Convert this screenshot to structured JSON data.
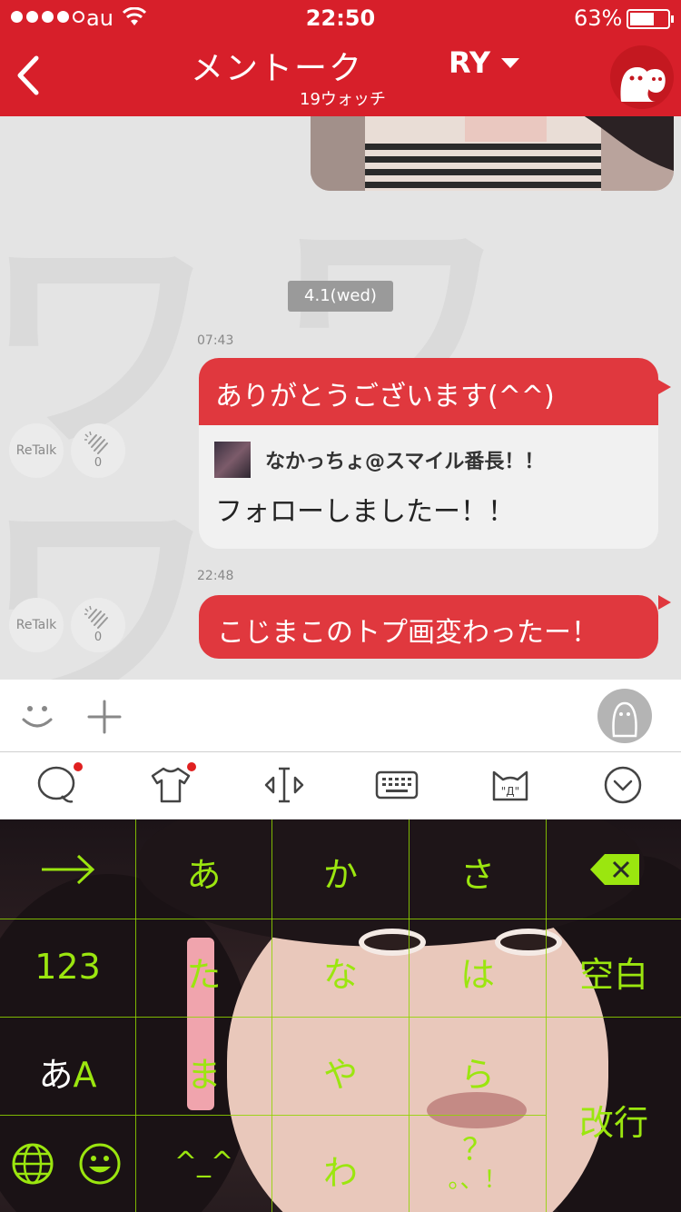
{
  "status_bar": {
    "carrier": "au",
    "time": "22:50",
    "battery": "63%",
    "signal_bars_filled": 4,
    "signal_bars_total": 5
  },
  "nav": {
    "title": "メントーク",
    "subtitle": "19ウォッチ",
    "user_select": "RY"
  },
  "chat": {
    "date_separator": "4.1(wed)",
    "messages": [
      {
        "time": "07:43",
        "text": "ありがとうございます(^^)",
        "quote_name": "なかっちょ@スマイル番長！！",
        "quote_text": "フォローしましたー！！",
        "retalk_label": "ReTalk",
        "clap_count": "0"
      },
      {
        "time": "22:48",
        "text": "こじまこのトプ画変わったー！",
        "retalk_label": "ReTalk",
        "clap_count": "0"
      }
    ]
  },
  "input_bar": {
    "icons": [
      "smile-icon",
      "plus-icon",
      "stamp-avatar"
    ]
  },
  "kb_toolbar": {
    "icons": [
      "chat-bubble-icon",
      "tshirt-icon",
      "cursor-move-icon",
      "keyboard-icon",
      "cat-face-icon",
      "chevron-down-icon"
    ]
  },
  "keyboard": {
    "accent_color": "#9be60f",
    "row1": {
      "k1": "→",
      "k2": "あ",
      "k3": "か",
      "k4": "さ"
    },
    "row2": {
      "k1": "123",
      "k2": "た",
      "k3": "な",
      "k4": "は",
      "k5": "空白"
    },
    "row3": {
      "k1a": "あ",
      "k1b": "A",
      "k2": "ま",
      "k3": "や",
      "k4": "ら",
      "k5": "改行"
    },
    "row4": {
      "k2": "^_^",
      "k3": "わ",
      "k4a": "？",
      "k4b": "。、！"
    }
  }
}
